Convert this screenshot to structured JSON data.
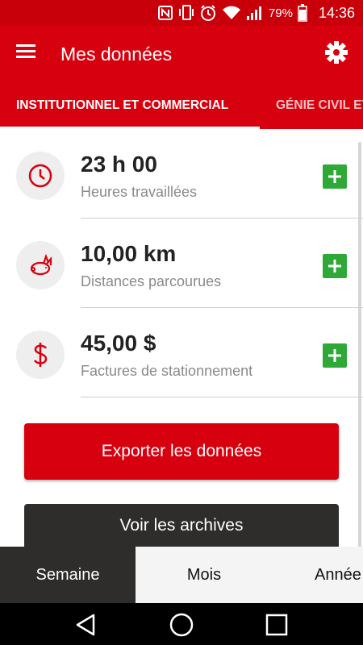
{
  "status_bar": {
    "battery": "79%",
    "time": "14:36",
    "icons": [
      "nfc-icon",
      "vibrate-icon",
      "alarm-icon",
      "wifi-icon",
      "signal-icon",
      "battery-icon"
    ]
  },
  "app_bar": {
    "title": "Mes données",
    "menu_icon": "hamburger-menu-icon",
    "settings_icon": "gear-icon"
  },
  "tabs": {
    "items": [
      {
        "label": "INSTITUTIONNEL ET COMMERCIAL",
        "active": true
      },
      {
        "label": "GÉNIE CIVIL ET VOIRIE",
        "active": false
      }
    ]
  },
  "stats": {
    "items": [
      {
        "value": "23 h 00",
        "label": "Heures travaillées",
        "icon": "clock-icon"
      },
      {
        "value": "10,00 km",
        "label": "Distances parcourues",
        "icon": "rabbit-icon"
      },
      {
        "value": "45,00 $",
        "label": "Factures de stationnement",
        "icon": "dollar-icon"
      }
    ],
    "add_icon": "plus-icon"
  },
  "actions": {
    "export_label": "Exporter les données",
    "archives_label": "Voir les archives"
  },
  "period_tabs": {
    "items": [
      {
        "label": "Semaine",
        "active": true
      },
      {
        "label": "Mois",
        "active": false
      },
      {
        "label": "Année",
        "active": false
      }
    ]
  },
  "colors": {
    "primary_red": "#d7000f",
    "status_red": "#c8000a",
    "add_green": "#2ea836",
    "dark_button": "#2f2d2c"
  }
}
